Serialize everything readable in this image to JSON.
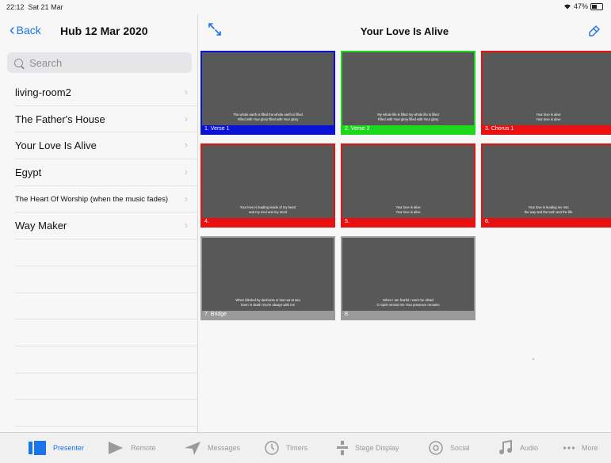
{
  "status": {
    "time": "22:12",
    "date": "Sat 21 Mar",
    "battery": "47%",
    "battery_level": 0.47
  },
  "nav": {
    "back_label": "Back",
    "title": "Hub 12 Mar 2020"
  },
  "search": {
    "placeholder": "Search"
  },
  "songs": [
    "living-room2",
    "The Father's House",
    "Your Love Is Alive",
    "Egypt",
    "The Heart Of Worship (when the music fades)",
    "Way Maker"
  ],
  "header": {
    "title": "Your Love Is Alive"
  },
  "slides": [
    {
      "label": "1. Verse 1",
      "color": "#0a12d6",
      "lines": [
        "The whole earth is filled the whole earth is filled",
        "Filled with Your glory filled with Your glory"
      ]
    },
    {
      "label": "2. Verse 2",
      "color": "#1cd81c",
      "lines": [
        "My whole life is filled my whole life is filled",
        "Filled with Your glory filled with Your glory"
      ]
    },
    {
      "label": "3. Chorus 1",
      "color": "#e81010",
      "lines": [
        "Your love is alive",
        "Your love is alive"
      ]
    },
    {
      "label": "4.",
      "color": "#e81010",
      "lines": [
        "Your love is leading inside of my heart",
        "and my soul and my mind"
      ]
    },
    {
      "label": "5.",
      "color": "#e81010",
      "lines": [
        "Your love is alive",
        "Your love is alive"
      ]
    },
    {
      "label": "6.",
      "color": "#e81010",
      "lines": [
        "Your love is leading me into",
        "the way and the truth and the life"
      ]
    },
    {
      "label": "7. Bridge",
      "color": "#9a9a9a",
      "lines": [
        "When blinded by darkness or lost out at sea",
        "Even in death You're always with me"
      ]
    },
    {
      "label": "8.",
      "color": "#9a9a9a",
      "lines": [
        "When I am fearful I won't be afraid",
        "O Spirit remind me Your presence remains"
      ]
    }
  ],
  "tabs": [
    {
      "label": "Presenter",
      "icon": "presenter-icon",
      "active": true
    },
    {
      "label": "Remote",
      "icon": "play-icon"
    },
    {
      "label": "Messages",
      "icon": "messages-icon"
    },
    {
      "label": "Timers",
      "icon": "timer-icon"
    },
    {
      "label": "Stage Display",
      "icon": "stage-display-icon"
    },
    {
      "label": "Social",
      "icon": "at-icon"
    },
    {
      "label": "Audio",
      "icon": "music-note-icon"
    },
    {
      "label": "More",
      "icon": "more-icon"
    }
  ],
  "colors": {
    "accent": "#1a73e8",
    "inactive": "#9a9a9a"
  }
}
